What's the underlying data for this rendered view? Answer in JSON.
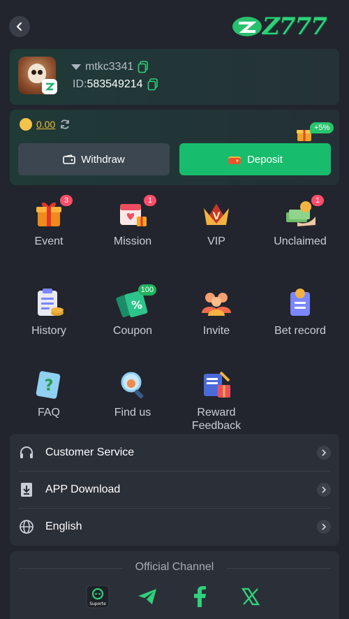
{
  "header": {
    "logo_text": "Z777"
  },
  "profile": {
    "username": "mtkc3341",
    "id_label": "ID:",
    "id_value": "583549214"
  },
  "wallet": {
    "balance": "0.00",
    "withdraw_label": "Withdraw",
    "deposit_label": "Deposit",
    "deposit_bonus": "+5%"
  },
  "menu": {
    "items": [
      {
        "label": "Event",
        "badge": "3",
        "icon": "gift-box-icon"
      },
      {
        "label": "Mission",
        "badge": "1",
        "icon": "calendar-gift-icon"
      },
      {
        "label": "VIP",
        "badge": "",
        "icon": "crown-icon"
      },
      {
        "label": "Unclaimed",
        "badge": "1",
        "icon": "money-hand-icon"
      },
      {
        "label": "History",
        "badge": "",
        "icon": "clipboard-coins-icon"
      },
      {
        "label": "Coupon",
        "badge": "100",
        "icon": "coupon-icon"
      },
      {
        "label": "Invite",
        "badge": "",
        "icon": "people-icon"
      },
      {
        "label": "Bet record",
        "badge": "",
        "icon": "bet-record-icon"
      },
      {
        "label": "FAQ",
        "badge": "",
        "icon": "faq-icon"
      },
      {
        "label": "Find us",
        "badge": "",
        "icon": "magnifier-icon"
      },
      {
        "label": "Reward Feedback",
        "badge": "",
        "icon": "book-gift-icon"
      }
    ]
  },
  "settings": {
    "items": [
      {
        "label": "Customer Service",
        "icon": "headset-icon"
      },
      {
        "label": "APP Download",
        "icon": "download-icon"
      },
      {
        "label": "English",
        "icon": "globe-icon"
      }
    ]
  },
  "channel": {
    "title": "Official Channel",
    "support_label": "Suporte"
  },
  "colors": {
    "accent_green": "#17bd6c",
    "balance_gold": "#f4bd33",
    "badge_red": "#ff4d6a",
    "background": "#22252d"
  }
}
